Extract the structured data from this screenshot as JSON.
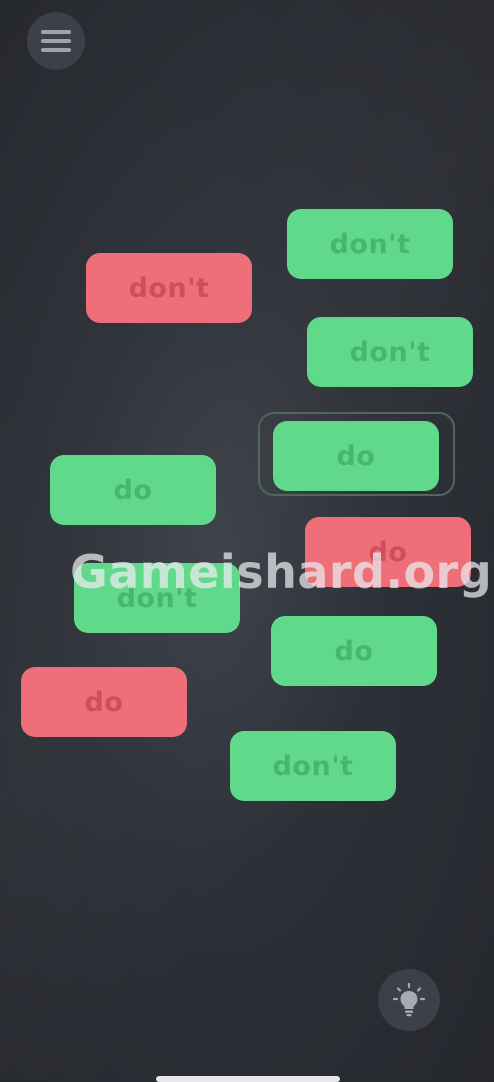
{
  "toolbar": {
    "menu_icon": "hamburger-menu-icon",
    "hint_icon": "lightbulb-icon"
  },
  "colors": {
    "background": "#2d3037",
    "green_tile": "#61d98a",
    "green_text": "#46b86c",
    "red_tile": "#ee6f78",
    "red_text": "#d04e5a"
  },
  "tiles": [
    {
      "label": "don't",
      "color": "green"
    },
    {
      "label": "don't",
      "color": "red"
    },
    {
      "label": "don't",
      "color": "green"
    },
    {
      "label": "do",
      "color": "green",
      "selected": true
    },
    {
      "label": "do",
      "color": "green"
    },
    {
      "label": "do",
      "color": "red"
    },
    {
      "label": "don't",
      "color": "green"
    },
    {
      "label": "do",
      "color": "green"
    },
    {
      "label": "do",
      "color": "red"
    },
    {
      "label": "don't",
      "color": "green"
    }
  ],
  "watermark": "Gameishard.org"
}
